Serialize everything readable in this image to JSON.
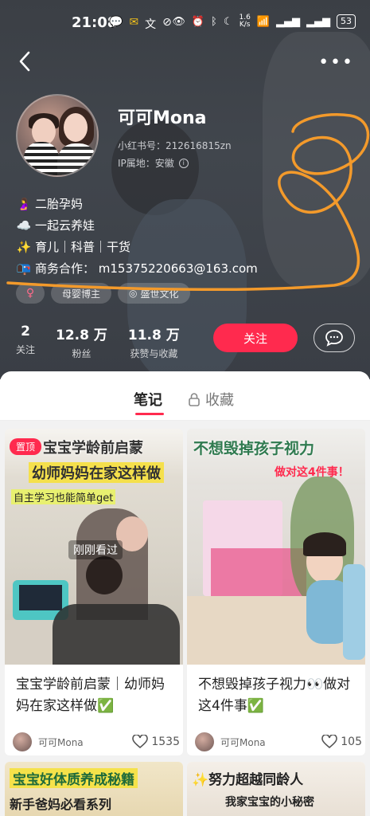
{
  "status_bar": {
    "time": "21:08",
    "net_speed_top": "1.6",
    "net_speed_bottom": "K/s",
    "battery": "53"
  },
  "profile": {
    "username": "可可Mona",
    "red_id": "小红书号：212616815zn",
    "ip": "IP属地：安徽",
    "bio": [
      {
        "emoji": "🤰",
        "text": "二胎孕妈"
      },
      {
        "emoji": "☁️",
        "text": "一起云养娃"
      },
      {
        "emoji": "✨",
        "text": "育儿｜科普｜干货"
      },
      {
        "emoji": "📭",
        "text": "商务合作：  m15375220663@163.com"
      }
    ],
    "tags": {
      "gender": "♀",
      "tag1": "母婴博主",
      "tag2": "盛世文化"
    },
    "stats": [
      {
        "num": "2",
        "label": "关注"
      },
      {
        "num": "12.8 万",
        "label": "粉丝"
      },
      {
        "num": "11.8 万",
        "label": "获赞与收藏"
      }
    ],
    "follow_label": "关注"
  },
  "tabs": {
    "notes": "笔记",
    "collect": "收藏"
  },
  "cards": [
    {
      "title": "宝宝学龄前启蒙｜幼师妈妈在家这样做✅",
      "author": "可可Mona",
      "likes": "1535",
      "pin_badge": "置顶",
      "overlay_line1": "宝宝学龄前启蒙",
      "overlay_line2": "幼师妈妈在家这样做",
      "overlay_line3": "自主学习也能简单get",
      "recent_label": "刚刚看过"
    },
    {
      "title": "不想毁掉孩子视力👀做对这4件事✅",
      "author": "可可Mona",
      "likes": "105",
      "overlay_line1": "不想毁掉孩子视力",
      "overlay_line2": "做对这4件事！"
    },
    {
      "overlay_line1": "宝宝好体质养成秘籍",
      "overlay_line2": "新手爸妈必看系列"
    },
    {
      "overlay_line1": "✨努力超越同龄人",
      "overlay_line2": "我家宝宝的小秘密"
    }
  ]
}
